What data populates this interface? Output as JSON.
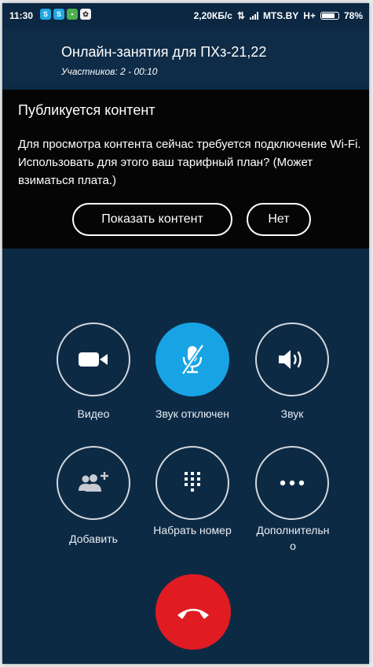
{
  "status_bar": {
    "time": "11:30",
    "speed": "2,20КБ/с",
    "carrier": "MTS.BY",
    "network": "H+",
    "battery_percent": "78%",
    "battery_level": 0.78
  },
  "header": {
    "title": "Онлайн-занятия для ПХз-21,22",
    "subtitle": "Участников: 2 - 00:10"
  },
  "notice": {
    "title": "Публикуется контент",
    "body": "Для просмотра контента сейчас требуется подключение Wi-Fi. Использовать для этого ваш тарифный план? (Может взиматься плата.)",
    "show_button": "Показать контент",
    "no_button": "Нет"
  },
  "controls": {
    "video": "Видео",
    "mute": "Звук отключен",
    "speaker": "Звук",
    "add": "Добавить",
    "dialpad": "Набрать номер",
    "more": "Дополнительно"
  },
  "colors": {
    "background": "#0d2a45",
    "accent": "#18a4e4",
    "end_call": "#e11b22"
  }
}
